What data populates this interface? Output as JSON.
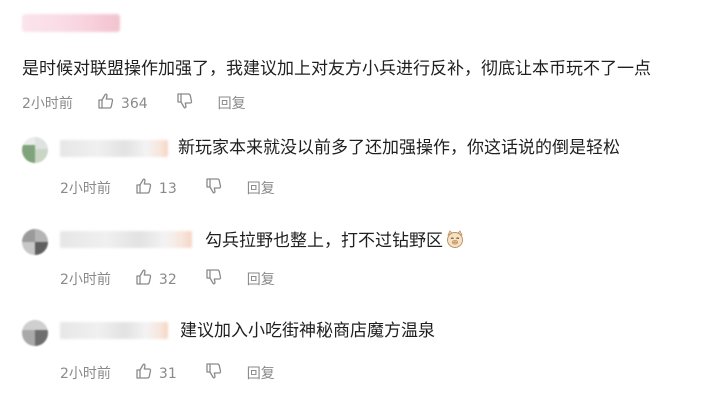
{
  "top_comment": {
    "text": "是时候对联盟操作加强了，我建议加上对友方小兵进行反补，彻底让本币玩不了一点",
    "time": "2小时前",
    "likes": "364",
    "reply_label": "回复"
  },
  "replies": [
    {
      "text": "新玩家本来就没以前多了还加强操作，你这话说的倒是轻松",
      "time": "2小时前",
      "likes": "13",
      "reply_label": "回复"
    },
    {
      "text": "勾兵拉野也整上，打不过钻野区",
      "emoji": "smirk-pig-emoji",
      "time": "2小时前",
      "likes": "32",
      "reply_label": "回复"
    },
    {
      "text": "建议加入小吃街神秘商店魔方温泉",
      "time": "2小时前",
      "likes": "31",
      "reply_label": "回复"
    }
  ],
  "icons": {
    "like": "thumbs-up-icon",
    "dislike": "thumbs-down-icon"
  },
  "colors": {
    "meta_text": "#8a8a8a",
    "body_text": "#1f1f1f",
    "background": "#ffffff"
  }
}
